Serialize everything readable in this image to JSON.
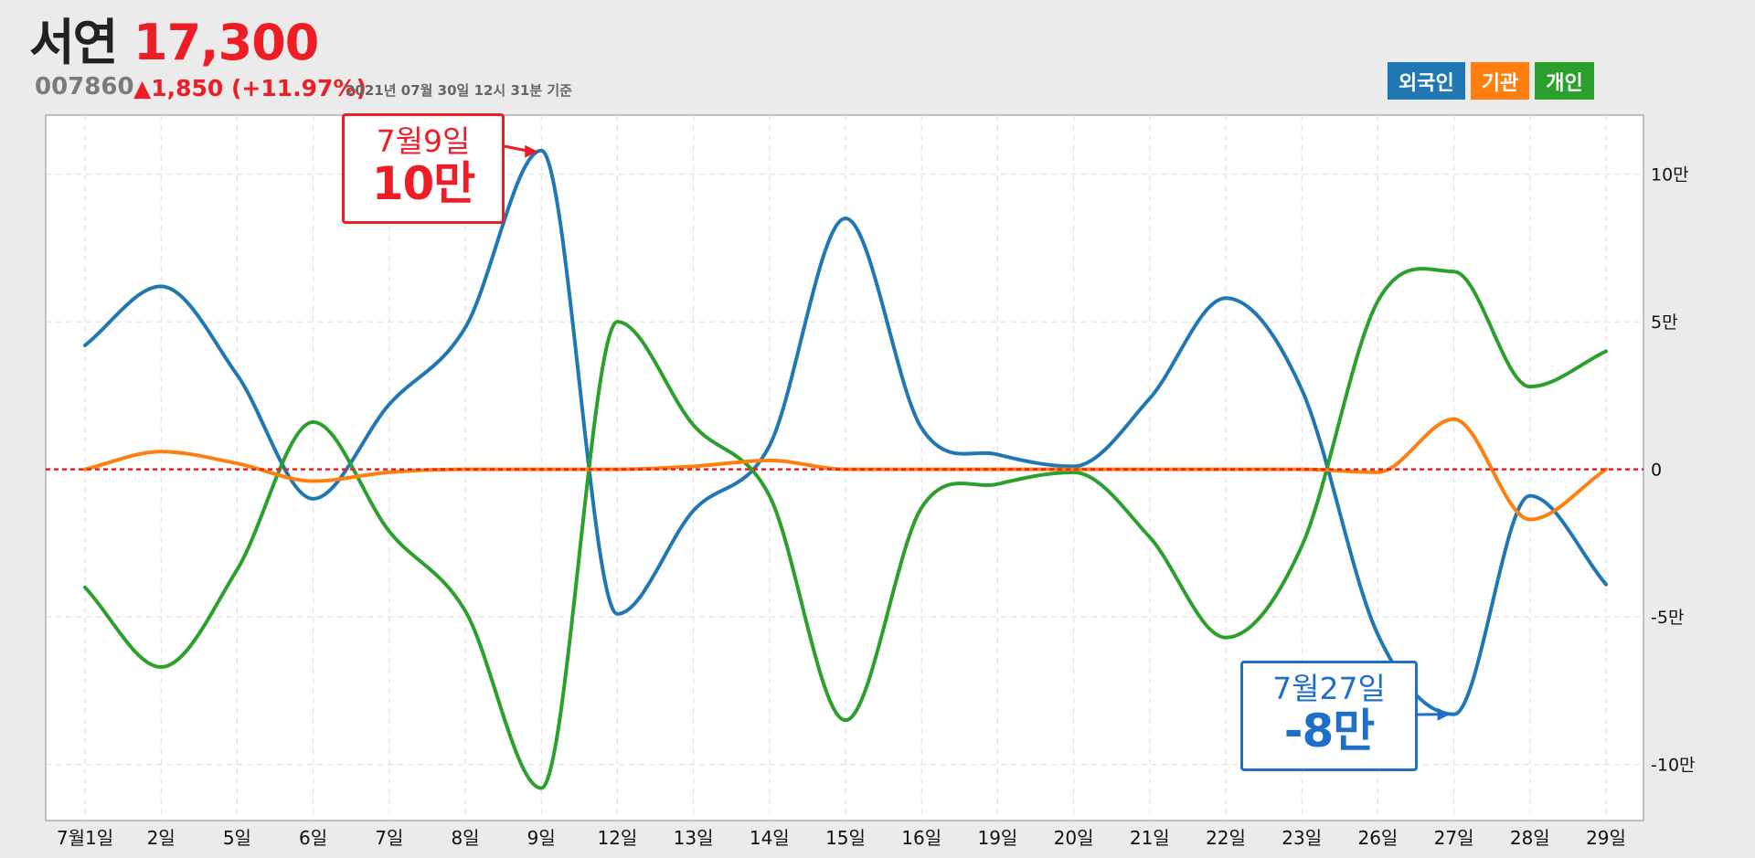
{
  "header": {
    "name": "서연",
    "price": "17,300",
    "code": "007860",
    "change": "▲1,850 (+11.97%)",
    "timestamp": "2021년 07월 30일 12시 31분 기준"
  },
  "annotations": {
    "max": {
      "date": "7월9일",
      "value": "10만",
      "color": "#ee1c25"
    },
    "min": {
      "date": "7월27일",
      "value": "-8만",
      "color": "#1f6fc9"
    }
  },
  "chart_data": {
    "type": "line",
    "categories": [
      "7월1일",
      "2일",
      "5일",
      "6일",
      "7일",
      "8일",
      "9일",
      "12일",
      "13일",
      "14일",
      "15일",
      "16일",
      "19일",
      "20일",
      "21일",
      "22일",
      "23일",
      "26일",
      "27일",
      "28일",
      "29일"
    ],
    "series": [
      {
        "name": "외국인",
        "color": "#1f77b4",
        "values": [
          4.2,
          6.2,
          3.2,
          -1.0,
          2.2,
          4.8,
          10.8,
          -4.9,
          -1.4,
          0.8,
          8.5,
          1.4,
          0.5,
          0.1,
          2.4,
          5.8,
          2.7,
          -5.6,
          -8.3,
          -0.9,
          -3.9
        ]
      },
      {
        "name": "기관",
        "color": "#ff7f0e",
        "values": [
          0.0,
          0.6,
          0.2,
          -0.4,
          -0.1,
          0.0,
          0.0,
          0.0,
          0.1,
          0.3,
          0.0,
          0.0,
          0.0,
          0.0,
          0.0,
          0.0,
          0.0,
          -0.1,
          1.7,
          -1.7,
          0.0
        ]
      },
      {
        "name": "개인",
        "color": "#2ca02c",
        "values": [
          -4.0,
          -6.7,
          -3.4,
          1.6,
          -2.1,
          -4.8,
          -10.8,
          5.0,
          1.5,
          -0.9,
          -8.5,
          -1.3,
          -0.5,
          -0.1,
          -2.3,
          -5.7,
          -2.6,
          5.7,
          6.7,
          2.8,
          4.0
        ]
      }
    ],
    "y_ticks": [
      10,
      5,
      0,
      -5,
      -10
    ],
    "y_tick_labels": [
      "10만",
      "5만",
      "0",
      "-5만",
      "-10만"
    ],
    "ylim": [
      -11.9,
      12.0
    ],
    "grid": true,
    "zero_line_color": "#ee1c25",
    "legend_position": "top-right"
  }
}
